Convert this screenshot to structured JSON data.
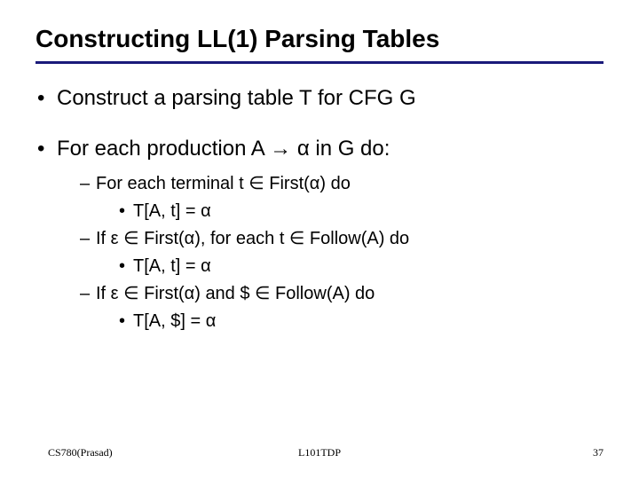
{
  "title": "Constructing LL(1) Parsing Tables",
  "bullets": {
    "b1": "Construct a parsing table T for CFG G",
    "b2": "For each production  A → α in G do:",
    "sub1": "For each terminal t ∈ First(α) do",
    "sub1a": "T[A, t] = α",
    "sub2": "If ε ∈ First(α), for each t ∈ Follow(A) do",
    "sub2a": "T[A, t] = α",
    "sub3": "If ε ∈ First(α) and $ ∈ Follow(A) do",
    "sub3a": "T[A, $] = α"
  },
  "footer": {
    "left": "CS780(Prasad)",
    "center": "L101TDP",
    "right": "37"
  }
}
